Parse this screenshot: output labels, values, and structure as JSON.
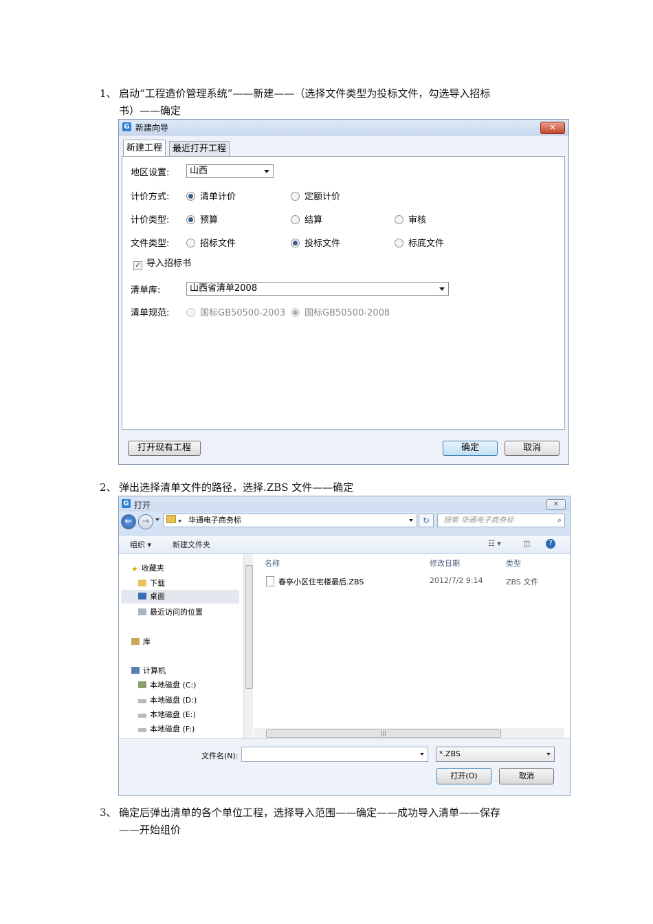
{
  "steps": [
    {
      "num": "1、",
      "line1": "启动“工程造价管理系统”——新建——（选择文件类型为投标文件，勾选导入招标",
      "line2": "书）——确定"
    },
    {
      "num": "2、",
      "line1": "弹出选择清单文件的路径，选择.ZBS 文件——确定"
    },
    {
      "num": "3、",
      "line1": "确定后弹出清单的各个单位工程，选择导入范围——确定——成功导入清单——保存",
      "line2": "——开始组价"
    }
  ],
  "wizard": {
    "title": "新建向导",
    "close": "✕",
    "tabs": [
      "新建工程",
      "最近打开工程"
    ],
    "region_label": "地区设置:",
    "region_value": "山西",
    "pricing_method_label": "计价方式:",
    "pricing_method_options": [
      "清单计价",
      "定额计价"
    ],
    "pricing_type_label": "计价类型:",
    "pricing_type_options": [
      "预算",
      "结算",
      "审核"
    ],
    "file_type_label": "文件类型:",
    "file_type_options": [
      "招标文件",
      "投标文件",
      "标底文件"
    ],
    "import_check": "导入招标书",
    "bill_lib_label": "清单库:",
    "bill_lib_value": "山西省清单2008",
    "bill_std_label": "清单规范:",
    "bill_std_options": [
      "国标GB50500-2003",
      "国标GB50500-2008"
    ],
    "open_existing": "打开现有工程",
    "ok": "确定",
    "cancel": "取消"
  },
  "open_dialog": {
    "title": "打开",
    "close": "✕",
    "path": "华通电子商务标",
    "search_placeholder": "搜索 华通电子商务标",
    "organize": "组织 ▾",
    "new_folder": "新建文件夹",
    "nav": {
      "favorites": "收藏夹",
      "downloads": "下载",
      "desktop": "桌面",
      "recent": "最近访问的位置",
      "library": "库",
      "computer": "计算机",
      "drives": [
        "本地磁盘 (C:)",
        "本地磁盘 (D:)",
        "本地磁盘 (E:)",
        "本地磁盘 (F:)"
      ]
    },
    "columns": {
      "name": "名称",
      "date": "修改日期",
      "type": "类型"
    },
    "files": [
      {
        "name": "春亭小区住宅楼最后.ZBS",
        "date": "2012/7/2 9:14",
        "type": "ZBS 文件"
      }
    ],
    "filename_label": "文件名(N):",
    "filetype_value": "*.ZBS",
    "open": "打开(O)",
    "cancel": "取消"
  }
}
